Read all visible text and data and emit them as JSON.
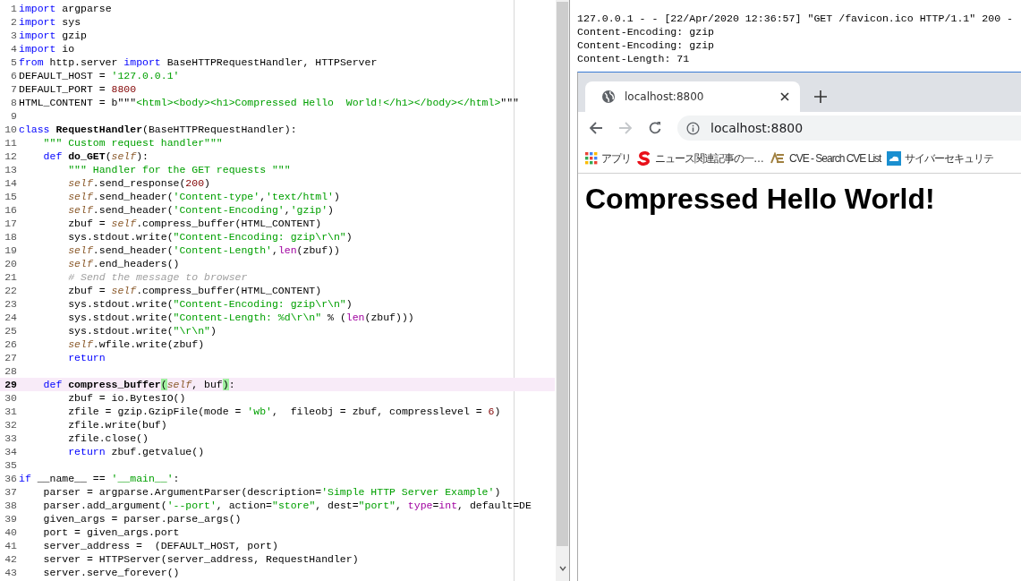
{
  "editor": {
    "lines": [
      {
        "number": "1",
        "current": false,
        "tokens": [
          {
            "kind": "kw",
            "text": "import"
          },
          {
            "kind": "plain",
            "text": " argparse"
          }
        ]
      },
      {
        "number": "2",
        "current": false,
        "tokens": [
          {
            "kind": "kw",
            "text": "import"
          },
          {
            "kind": "plain",
            "text": " sys"
          }
        ]
      },
      {
        "number": "3",
        "current": false,
        "tokens": [
          {
            "kind": "kw",
            "text": "import"
          },
          {
            "kind": "plain",
            "text": " gzip"
          }
        ]
      },
      {
        "number": "4",
        "current": false,
        "tokens": [
          {
            "kind": "kw",
            "text": "import"
          },
          {
            "kind": "plain",
            "text": " io"
          }
        ]
      },
      {
        "number": "5",
        "current": false,
        "tokens": [
          {
            "kind": "kw",
            "text": "from"
          },
          {
            "kind": "plain",
            "text": " http.server "
          },
          {
            "kind": "kw",
            "text": "import"
          },
          {
            "kind": "plain",
            "text": " BaseHTTPRequestHandler, HTTPServer"
          }
        ]
      },
      {
        "number": "6",
        "current": false,
        "tokens": [
          {
            "kind": "plain",
            "text": "DEFAULT_HOST = "
          },
          {
            "kind": "str",
            "text": "'127.0.0.1'"
          }
        ]
      },
      {
        "number": "7",
        "current": false,
        "tokens": [
          {
            "kind": "plain",
            "text": "DEFAULT_PORT = "
          },
          {
            "kind": "num",
            "text": "8800"
          }
        ]
      },
      {
        "number": "8",
        "current": false,
        "tokens": [
          {
            "kind": "plain",
            "text": "HTML_CONTENT = b\"\"\""
          },
          {
            "kind": "str",
            "text": "<html><body><h1>Compressed Hello  World!</h1></body></html>"
          },
          {
            "kind": "plain",
            "text": "\"\"\""
          }
        ]
      },
      {
        "number": "9",
        "current": false
      },
      {
        "number": "10",
        "current": false,
        "tokens": [
          {
            "kind": "kw",
            "text": "class "
          },
          {
            "kind": "name",
            "text": "RequestHandler"
          },
          {
            "kind": "plain",
            "text": "(BaseHTTPRequestHandler):"
          }
        ]
      },
      {
        "number": "11",
        "current": false,
        "tokens": [
          {
            "kind": "str",
            "text": "    \"\"\" Custom request handler\"\"\""
          }
        ]
      },
      {
        "number": "12",
        "current": false,
        "tokens": [
          {
            "kind": "kw",
            "text": "    def "
          },
          {
            "kind": "name",
            "text": "do_GET"
          },
          {
            "kind": "plain",
            "text": "("
          },
          {
            "kind": "self",
            "text": "self"
          },
          {
            "kind": "plain",
            "text": "):"
          }
        ]
      },
      {
        "number": "13",
        "current": false,
        "tokens": [
          {
            "kind": "str",
            "text": "        \"\"\" Handler for the GET requests \"\"\""
          }
        ]
      },
      {
        "number": "14",
        "current": false,
        "tokens": [
          {
            "kind": "self",
            "text": "        self"
          },
          {
            "kind": "plain",
            "text": ".send_response("
          },
          {
            "kind": "num",
            "text": "200"
          },
          {
            "kind": "plain",
            "text": ")"
          }
        ]
      },
      {
        "number": "15",
        "current": false,
        "tokens": [
          {
            "kind": "self",
            "text": "        self"
          },
          {
            "kind": "plain",
            "text": ".send_header("
          },
          {
            "kind": "str",
            "text": "'Content-type'"
          },
          {
            "kind": "plain",
            "text": ","
          },
          {
            "kind": "str",
            "text": "'text/html'"
          },
          {
            "kind": "plain",
            "text": ")"
          }
        ]
      },
      {
        "number": "16",
        "current": false,
        "tokens": [
          {
            "kind": "self",
            "text": "        self"
          },
          {
            "kind": "plain",
            "text": ".send_header("
          },
          {
            "kind": "str",
            "text": "'Content-Encoding'"
          },
          {
            "kind": "plain",
            "text": ","
          },
          {
            "kind": "str",
            "text": "'gzip'"
          },
          {
            "kind": "plain",
            "text": ")"
          }
        ]
      },
      {
        "number": "17",
        "current": false,
        "tokens": [
          {
            "kind": "plain",
            "text": "        zbuf = "
          },
          {
            "kind": "self",
            "text": "self"
          },
          {
            "kind": "plain",
            "text": ".compress_buffer(HTML_CONTENT)"
          }
        ]
      },
      {
        "number": "18",
        "current": false,
        "tokens": [
          {
            "kind": "plain",
            "text": "        sys.stdout.write("
          },
          {
            "kind": "str",
            "text": "\"Content-Encoding: gzip\\r\\n\""
          },
          {
            "kind": "plain",
            "text": ")"
          }
        ]
      },
      {
        "number": "19",
        "current": false,
        "tokens": [
          {
            "kind": "self",
            "text": "        self"
          },
          {
            "kind": "plain",
            "text": ".send_header("
          },
          {
            "kind": "str",
            "text": "'Content-Length'"
          },
          {
            "kind": "plain",
            "text": ","
          },
          {
            "kind": "builtin",
            "text": "len"
          },
          {
            "kind": "plain",
            "text": "(zbuf))"
          }
        ]
      },
      {
        "number": "20",
        "current": false,
        "tokens": [
          {
            "kind": "self",
            "text": "        self"
          },
          {
            "kind": "plain",
            "text": ".end_headers()"
          }
        ]
      },
      {
        "number": "21",
        "current": false,
        "tokens": [
          {
            "kind": "comment",
            "text": "        # Send the message to browser"
          }
        ]
      },
      {
        "number": "22",
        "current": false,
        "tokens": [
          {
            "kind": "plain",
            "text": "        zbuf = "
          },
          {
            "kind": "self",
            "text": "self"
          },
          {
            "kind": "plain",
            "text": ".compress_buffer(HTML_CONTENT)"
          }
        ]
      },
      {
        "number": "23",
        "current": false,
        "tokens": [
          {
            "kind": "plain",
            "text": "        sys.stdout.write("
          },
          {
            "kind": "str",
            "text": "\"Content-Encoding: gzip\\r\\n\""
          },
          {
            "kind": "plain",
            "text": ")"
          }
        ]
      },
      {
        "number": "24",
        "current": false,
        "tokens": [
          {
            "kind": "plain",
            "text": "        sys.stdout.write("
          },
          {
            "kind": "str",
            "text": "\"Content-Length: %d\\r\\n\""
          },
          {
            "kind": "plain",
            "text": " % ("
          },
          {
            "kind": "builtin",
            "text": "len"
          },
          {
            "kind": "plain",
            "text": "(zbuf)))"
          }
        ]
      },
      {
        "number": "25",
        "current": false,
        "tokens": [
          {
            "kind": "plain",
            "text": "        sys.stdout.write("
          },
          {
            "kind": "str",
            "text": "\"\\r\\n\""
          },
          {
            "kind": "plain",
            "text": ")"
          }
        ]
      },
      {
        "number": "26",
        "current": false,
        "tokens": [
          {
            "kind": "self",
            "text": "        self"
          },
          {
            "kind": "plain",
            "text": ".wfile.write(zbuf)"
          }
        ]
      },
      {
        "number": "27",
        "current": false,
        "tokens": [
          {
            "kind": "kw",
            "text": "        return"
          }
        ]
      },
      {
        "number": "28",
        "current": false
      },
      {
        "number": "29",
        "current": true,
        "tokens": [
          {
            "kind": "kw",
            "text": "    def "
          },
          {
            "kind": "name",
            "text": "compress_buffer"
          },
          {
            "kind": "match",
            "text": "("
          },
          {
            "kind": "self",
            "text": "self"
          },
          {
            "kind": "plain",
            "text": ", buf"
          },
          {
            "kind": "match",
            "text": ")"
          },
          {
            "kind": "plain",
            "text": ":"
          }
        ]
      },
      {
        "number": "30",
        "current": false,
        "tokens": [
          {
            "kind": "plain",
            "text": "        zbuf = io.BytesIO()"
          }
        ]
      },
      {
        "number": "31",
        "current": false,
        "tokens": [
          {
            "kind": "plain",
            "text": "        zfile = gzip.GzipFile(mode = "
          },
          {
            "kind": "str",
            "text": "'wb'"
          },
          {
            "kind": "plain",
            "text": ",  fileobj = zbuf, compresslevel = "
          },
          {
            "kind": "num",
            "text": "6"
          },
          {
            "kind": "plain",
            "text": ")"
          }
        ]
      },
      {
        "number": "32",
        "current": false,
        "tokens": [
          {
            "kind": "plain",
            "text": "        zfile.write(buf)"
          }
        ]
      },
      {
        "number": "33",
        "current": false,
        "tokens": [
          {
            "kind": "plain",
            "text": "        zfile.close()"
          }
        ]
      },
      {
        "number": "34",
        "current": false,
        "tokens": [
          {
            "kind": "kw",
            "text": "        return"
          },
          {
            "kind": "plain",
            "text": " zbuf.getvalue()"
          }
        ]
      },
      {
        "number": "35",
        "current": false
      },
      {
        "number": "36",
        "current": false,
        "tokens": [
          {
            "kind": "kw",
            "text": "if"
          },
          {
            "kind": "plain",
            "text": " __name__ == "
          },
          {
            "kind": "str",
            "text": "'__main__'"
          },
          {
            "kind": "plain",
            "text": ":"
          }
        ]
      },
      {
        "number": "37",
        "current": false,
        "tokens": [
          {
            "kind": "plain",
            "text": "    parser = argparse.ArgumentParser(description="
          },
          {
            "kind": "str",
            "text": "'Simple HTTP Server Example'"
          },
          {
            "kind": "plain",
            "text": ")"
          }
        ]
      },
      {
        "number": "38",
        "current": false,
        "tokens": [
          {
            "kind": "plain",
            "text": "    parser.add_argument("
          },
          {
            "kind": "str",
            "text": "'--port'"
          },
          {
            "kind": "plain",
            "text": ", action="
          },
          {
            "kind": "str",
            "text": "\"store\""
          },
          {
            "kind": "plain",
            "text": ", dest="
          },
          {
            "kind": "str",
            "text": "\"port\""
          },
          {
            "kind": "plain",
            "text": ", "
          },
          {
            "kind": "builtin",
            "text": "type"
          },
          {
            "kind": "plain",
            "text": "="
          },
          {
            "kind": "builtin",
            "text": "int"
          },
          {
            "kind": "plain",
            "text": ", default=DE"
          }
        ]
      },
      {
        "number": "39",
        "current": false,
        "tokens": [
          {
            "kind": "plain",
            "text": "    given_args = parser.parse_args()"
          }
        ]
      },
      {
        "number": "40",
        "current": false,
        "tokens": [
          {
            "kind": "plain",
            "text": "    port = given_args.port"
          }
        ]
      },
      {
        "number": "41",
        "current": false,
        "tokens": [
          {
            "kind": "plain",
            "text": "    server_address =  (DEFAULT_HOST, port)"
          }
        ]
      },
      {
        "number": "42",
        "current": false,
        "tokens": [
          {
            "kind": "plain",
            "text": "    server = HTTPServer(server_address, RequestHandler)"
          }
        ]
      },
      {
        "number": "43",
        "current": false,
        "tokens": [
          {
            "kind": "plain",
            "text": "    server.serve_forever()"
          }
        ]
      }
    ]
  },
  "console": {
    "lines": [
      "127.0.0.1 - - [22/Apr/2020 12:36:57] \"GET /favicon.ico HTTP/1.1\" 200 -",
      "Content-Encoding: gzip",
      "Content-Encoding: gzip",
      "Content-Length: 71"
    ]
  },
  "browser": {
    "tab": {
      "title": "localhost:8800",
      "selected": true
    },
    "forward_disabled": true,
    "address": "localhost:8800",
    "bookmarks": [
      {
        "kind": "apps",
        "label": "アプリ"
      },
      {
        "kind": "s",
        "label": "ニュース関連記事の一…"
      },
      {
        "kind": "cve",
        "label": "CVE - Search CVE List"
      },
      {
        "kind": "cloud",
        "label": "サイバーセキュリテ"
      }
    ],
    "heading": "Compressed Hello World!"
  }
}
